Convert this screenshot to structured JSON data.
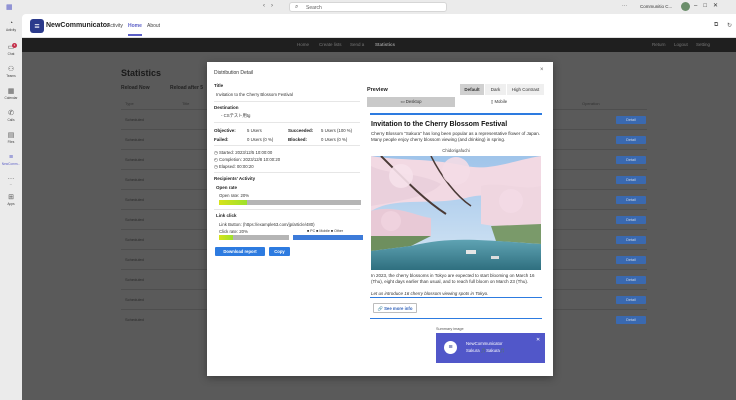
{
  "titlebar": {
    "search_placeholder": "Search",
    "org": "Communitio C..."
  },
  "rail": [
    {
      "label": "Activity",
      "icon": "bell-icon"
    },
    {
      "label": "Chat",
      "icon": "chat-icon",
      "badge": "1"
    },
    {
      "label": "Teams",
      "icon": "teams-icon"
    },
    {
      "label": "Calendar",
      "icon": "calendar-icon"
    },
    {
      "label": "Calls",
      "icon": "phone-icon"
    },
    {
      "label": "Files",
      "icon": "file-icon"
    },
    {
      "label": "NewComm...",
      "icon": "app-icon"
    },
    {
      "label": "...",
      "icon": "more-icon"
    },
    {
      "label": "Apps",
      "icon": "apps-icon"
    }
  ],
  "app": {
    "name": "NewCommunicator",
    "tabs": [
      "Activity",
      "Home",
      "About"
    ],
    "active_tab": "Home"
  },
  "background": {
    "nav_items": [
      "Home",
      "Create lists",
      "Send a",
      "Statistics"
    ],
    "nav_right": [
      "Return",
      "Logout",
      "Setting"
    ],
    "page_title": "Statistics",
    "tabs": [
      "Reload Now",
      "Reload after 5"
    ],
    "headers": [
      "Type",
      "Title",
      "Operation"
    ],
    "row_type": "Scheduled",
    "detail_label": "Detail"
  },
  "modal": {
    "title": "Distribution Detail",
    "close": "×",
    "title_label": "Title",
    "title_value": "Invitation to the Cherry Blossom Festival",
    "destination_label": "Destination",
    "destination_value": "- CSテスト用tg",
    "objective_label": "Objective:",
    "objective_value": "5 Users",
    "succeeded_label": "Succeeded:",
    "succeeded_value": "5 Users (100 %)",
    "failed_label": "Failed:",
    "failed_value": "0 Users (0 %)",
    "blocked_label": "Blocked:",
    "blocked_value": "0 Users (0 %)",
    "started": "Started: 2023/12/5 10:00:00",
    "completion": "Completion: 2023/12/8 10:00:20",
    "elapsed": "Elapsed: 00:00:20",
    "activity_label": "Recipients' Activity",
    "open_rate_label": "Open rate",
    "open_rate_text": "Open rate: 20%",
    "open_rate_fraction": 0.2,
    "link_click_label": "Link click",
    "link_button_text": "Link Button: (https://example63.com/jp/article/480)",
    "click_rate_text": "Click rate: 20%",
    "click_rate_fraction": 0.2,
    "legend_text": "■ PC ■ Mobile ■ Other",
    "download_label": "Download report",
    "copy_label": "Copy"
  },
  "preview": {
    "title": "Preview",
    "themes": [
      "Default",
      "Dark",
      "High Contrast"
    ],
    "active_theme": "Default",
    "devices": [
      "Desktop",
      "Mobile"
    ],
    "active_device": "Desktop",
    "card_title": "Invitation to the Cherry Blossom Festival",
    "card_intro": "Cherry Blossom \"Sakura\" has long been popular as a representative flower of Japan. Many people enjoy cherry blossom viewing (and drinking) in spring.",
    "image_caption": "Chidorigafuchi",
    "body_1": "In 2023, the cherry blossoms in Tokyo are expected to start blooming on March 16 (Thu), eight days earlier than usual, and to reach full bloom on March 23 (Thu).",
    "body_2": "Let us introduce 16 cherry blossom viewing spots in Tokyo.",
    "see_more": "See more info",
    "summary_label": "Summary image",
    "summary_app": "NewCommunicator",
    "summary_text": "Sakura 🎵Sakura🎵"
  },
  "colors": {
    "accent": "#5b5fc7",
    "button_blue": "#2d7be0",
    "summary_bg": "#5157c9"
  }
}
